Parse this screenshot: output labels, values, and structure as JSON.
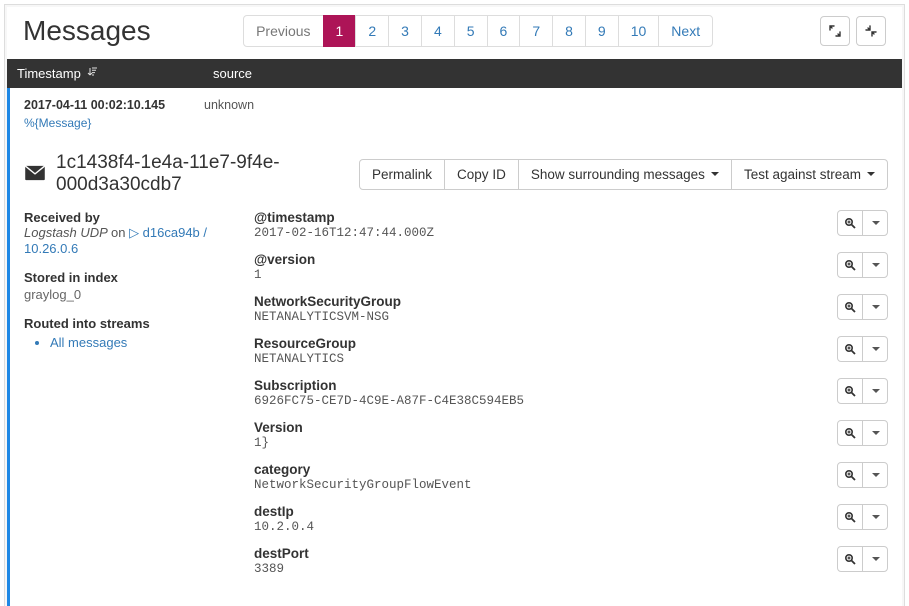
{
  "title": "Messages",
  "pagination": {
    "prev": "Previous",
    "pages": [
      "1",
      "2",
      "3",
      "4",
      "5",
      "6",
      "7",
      "8",
      "9",
      "10"
    ],
    "active": 0,
    "next": "Next"
  },
  "columns": {
    "timestamp": "Timestamp",
    "source": "source"
  },
  "row": {
    "timestamp": "2017-04-11 00:02:10.145",
    "source": "unknown",
    "template": "%{Message}"
  },
  "message": {
    "id": "1c1438f4-1e4a-11e7-9f4e-000d3a30cdb7",
    "actions": {
      "permalink": "Permalink",
      "copy_id": "Copy ID",
      "surrounding": "Show surrounding messages",
      "test_stream": "Test against stream"
    },
    "meta": {
      "received_label": "Received by",
      "received_input": "Logstash UDP",
      "received_on": "on",
      "received_node": "d16ca94b / 10.26.0.6",
      "stored_label": "Stored in index",
      "stored_value": "graylog_0",
      "streams_label": "Routed into streams",
      "streams_item": "All messages"
    },
    "fields": [
      {
        "name": "@timestamp",
        "value": "2017-02-16T12:47:44.000Z"
      },
      {
        "name": "@version",
        "value": "1"
      },
      {
        "name": "NetworkSecurityGroup",
        "value": "NETANALYTICSVM-NSG"
      },
      {
        "name": "ResourceGroup",
        "value": "NETANALYTICS"
      },
      {
        "name": "Subscription",
        "value": "6926FC75-CE7D-4C9E-A87F-C4E38C594EB5"
      },
      {
        "name": "Version",
        "value": "1}"
      },
      {
        "name": "category",
        "value": "NetworkSecurityGroupFlowEvent"
      },
      {
        "name": "destIp",
        "value": "10.2.0.4"
      },
      {
        "name": "destPort",
        "value": "3389"
      }
    ]
  }
}
